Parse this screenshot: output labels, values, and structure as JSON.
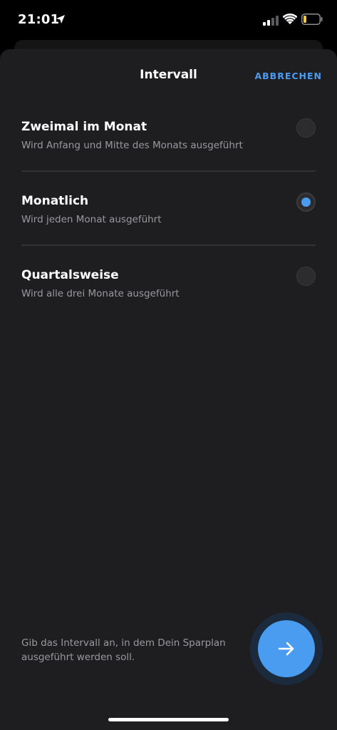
{
  "status_bar": {
    "time": "21:01",
    "icons": [
      "location-arrow-icon",
      "cellular-signal-icon",
      "wifi-icon",
      "battery-icon"
    ]
  },
  "sheet": {
    "title": "Intervall",
    "cancel_label": "ABBRECHEN"
  },
  "options": [
    {
      "title": "Zweimal im Monat",
      "subtitle": "Wird Anfang und Mitte des Monats ausgeführt",
      "selected": false
    },
    {
      "title": "Monatlich",
      "subtitle": "Wird jeden Monat ausgeführt",
      "selected": true
    },
    {
      "title": "Quartalsweise",
      "subtitle": "Wird alle drei Monate ausgeführt",
      "selected": false
    }
  ],
  "footer": {
    "hint": "Gib das Intervall an, in dem Dein Sparplan ausgeführt werden soll.",
    "next_icon": "arrow-right-icon"
  },
  "colors": {
    "accent": "#4a9cf0",
    "sheet_background": "#1e1e20",
    "battery_low": "#f2c94c"
  }
}
